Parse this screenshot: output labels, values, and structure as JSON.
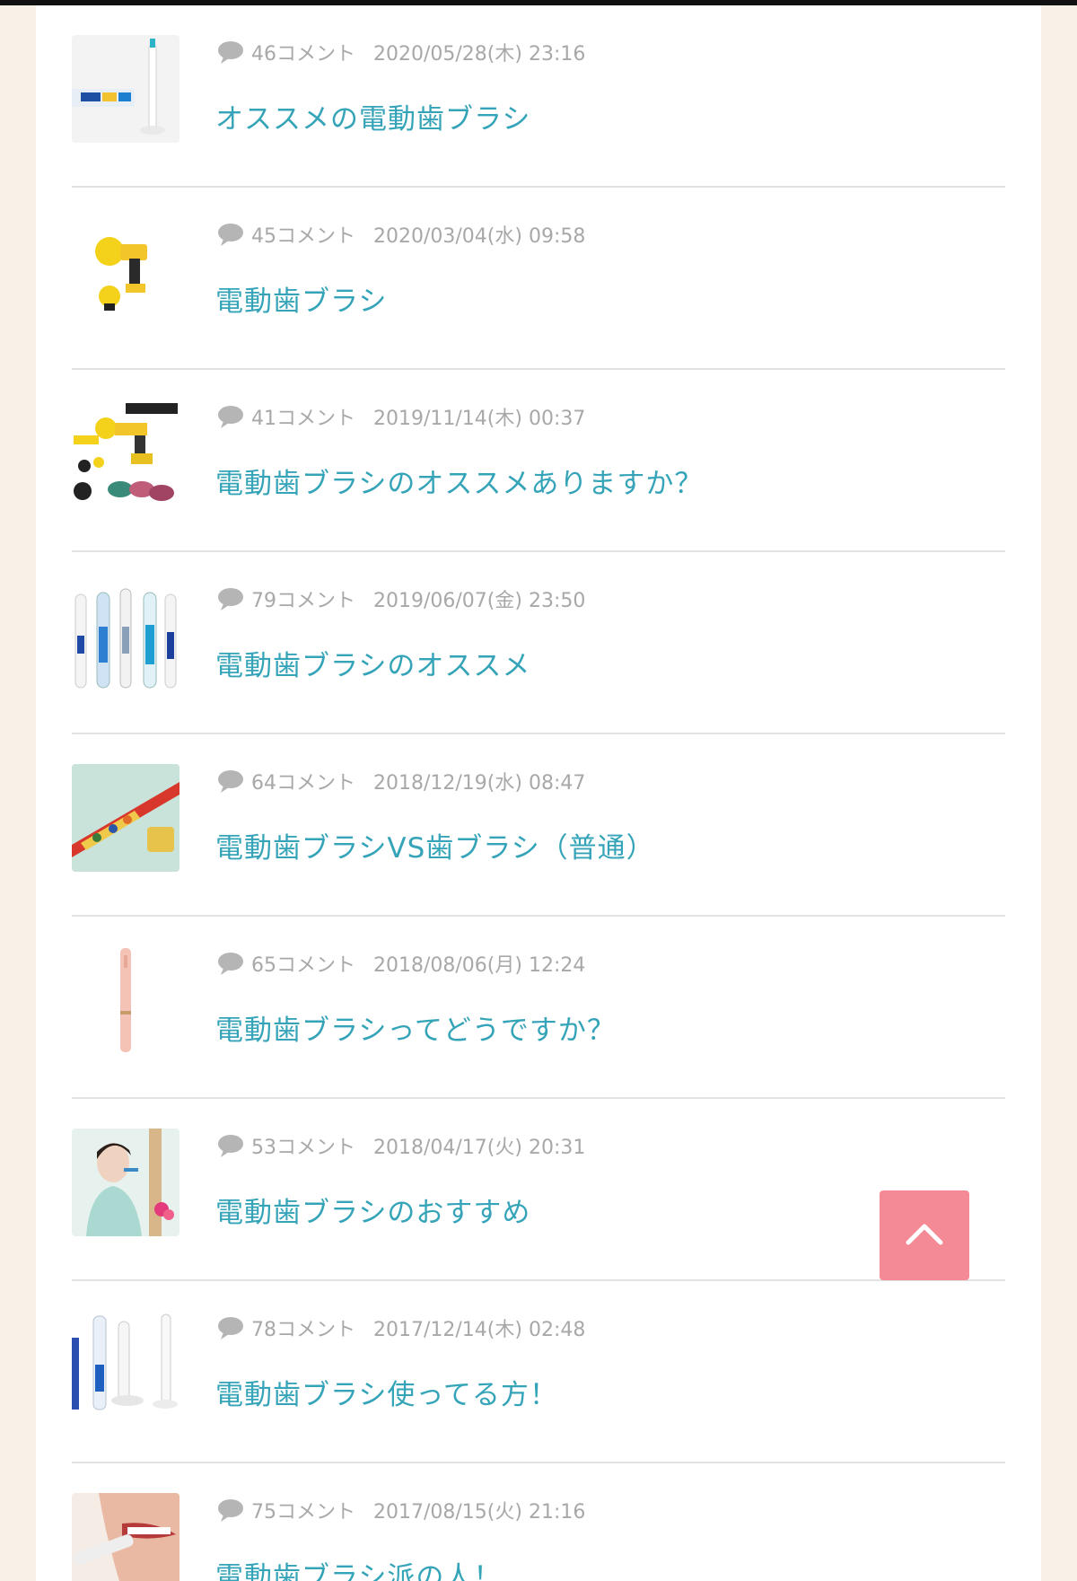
{
  "scroll_top_icon": "chevron-up-icon",
  "comment_icon": "speech-bubble-icon",
  "colors": {
    "title": "#35a4b8",
    "meta": "#a8a8a8",
    "scroll_button": "#f48a96"
  },
  "threads": [
    {
      "comments": "46コメント",
      "date": "2020/05/28(木) 23:16",
      "title": "オススメの電動歯ブラシ",
      "thumbnail": "electric-toothbrush-box-image"
    },
    {
      "comments": "45コメント",
      "date": "2020/03/04(水) 09:58",
      "title": "電動歯ブラシ",
      "thumbnail": "drill-brush-image"
    },
    {
      "comments": "41コメント",
      "date": "2019/11/14(木) 00:37",
      "title": "電動歯ブラシのオススメありますか？",
      "thumbnail": "drill-brush-set-image"
    },
    {
      "comments": "79コメント",
      "date": "2019/06/07(金) 23:50",
      "title": "電動歯ブラシのオススメ",
      "thumbnail": "toothbrush-lineup-image"
    },
    {
      "comments": "64コメント",
      "date": "2018/12/19(水) 08:47",
      "title": "電動歯ブラシVS歯ブラシ（普通）",
      "thumbnail": "red-toothbrush-image"
    },
    {
      "comments": "65コメント",
      "date": "2018/08/06(月) 12:24",
      "title": "電動歯ブラシってどうですか？",
      "thumbnail": "pink-toothbrush-image"
    },
    {
      "comments": "53コメント",
      "date": "2018/04/17(火) 20:31",
      "title": "電動歯ブラシのおすすめ",
      "thumbnail": "woman-brushing-image"
    },
    {
      "comments": "78コメント",
      "date": "2017/12/14(木) 02:48",
      "title": "電動歯ブラシ使ってる方！",
      "thumbnail": "toothbrush-stand-image"
    },
    {
      "comments": "75コメント",
      "date": "2017/08/15(火) 21:16",
      "title": "電動歯ブラシ派の人！",
      "thumbnail": "brushing-teeth-closeup-image"
    }
  ]
}
